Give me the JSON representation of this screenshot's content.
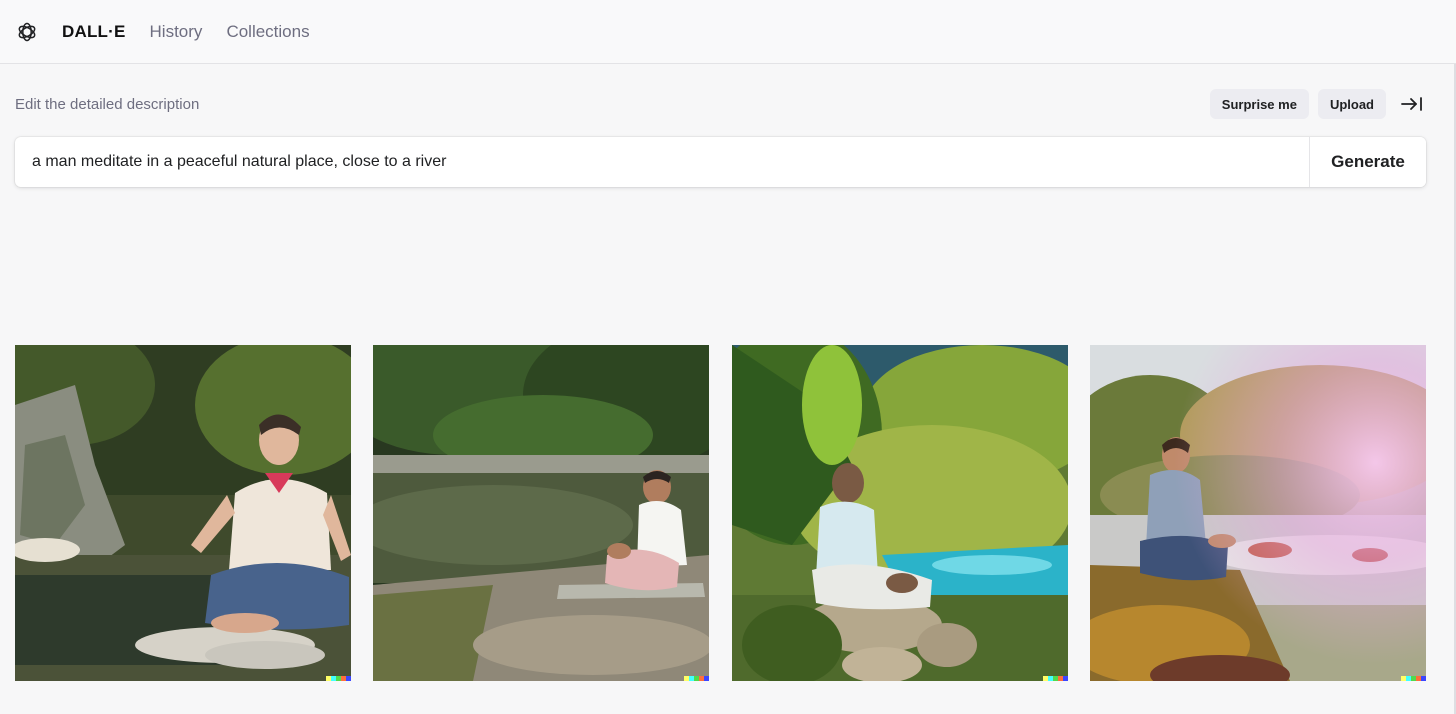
{
  "nav": {
    "brand": "DALL·E",
    "links": [
      "History",
      "Collections"
    ],
    "logo_icon": "openai-logo-icon"
  },
  "editor": {
    "label": "Edit the detailed description",
    "surprise_label": "Surprise me",
    "upload_label": "Upload",
    "collapse_icon": "collapse-right-icon",
    "prompt_value": "a man meditate in a peaceful natural place, close to a river",
    "generate_label": "Generate"
  },
  "results": {
    "images": [
      {
        "description": "man meditating on river rocks in front of mossy cliff"
      },
      {
        "description": "man meditating on mat beside calm river"
      },
      {
        "description": "man meditating on rocks by jungle stream"
      },
      {
        "description": "man meditating by rushing river in sunlight"
      }
    ],
    "signature_colors": [
      "#ffff66",
      "#42ffff",
      "#51da4c",
      "#ff6e3c",
      "#3c46ff"
    ]
  }
}
